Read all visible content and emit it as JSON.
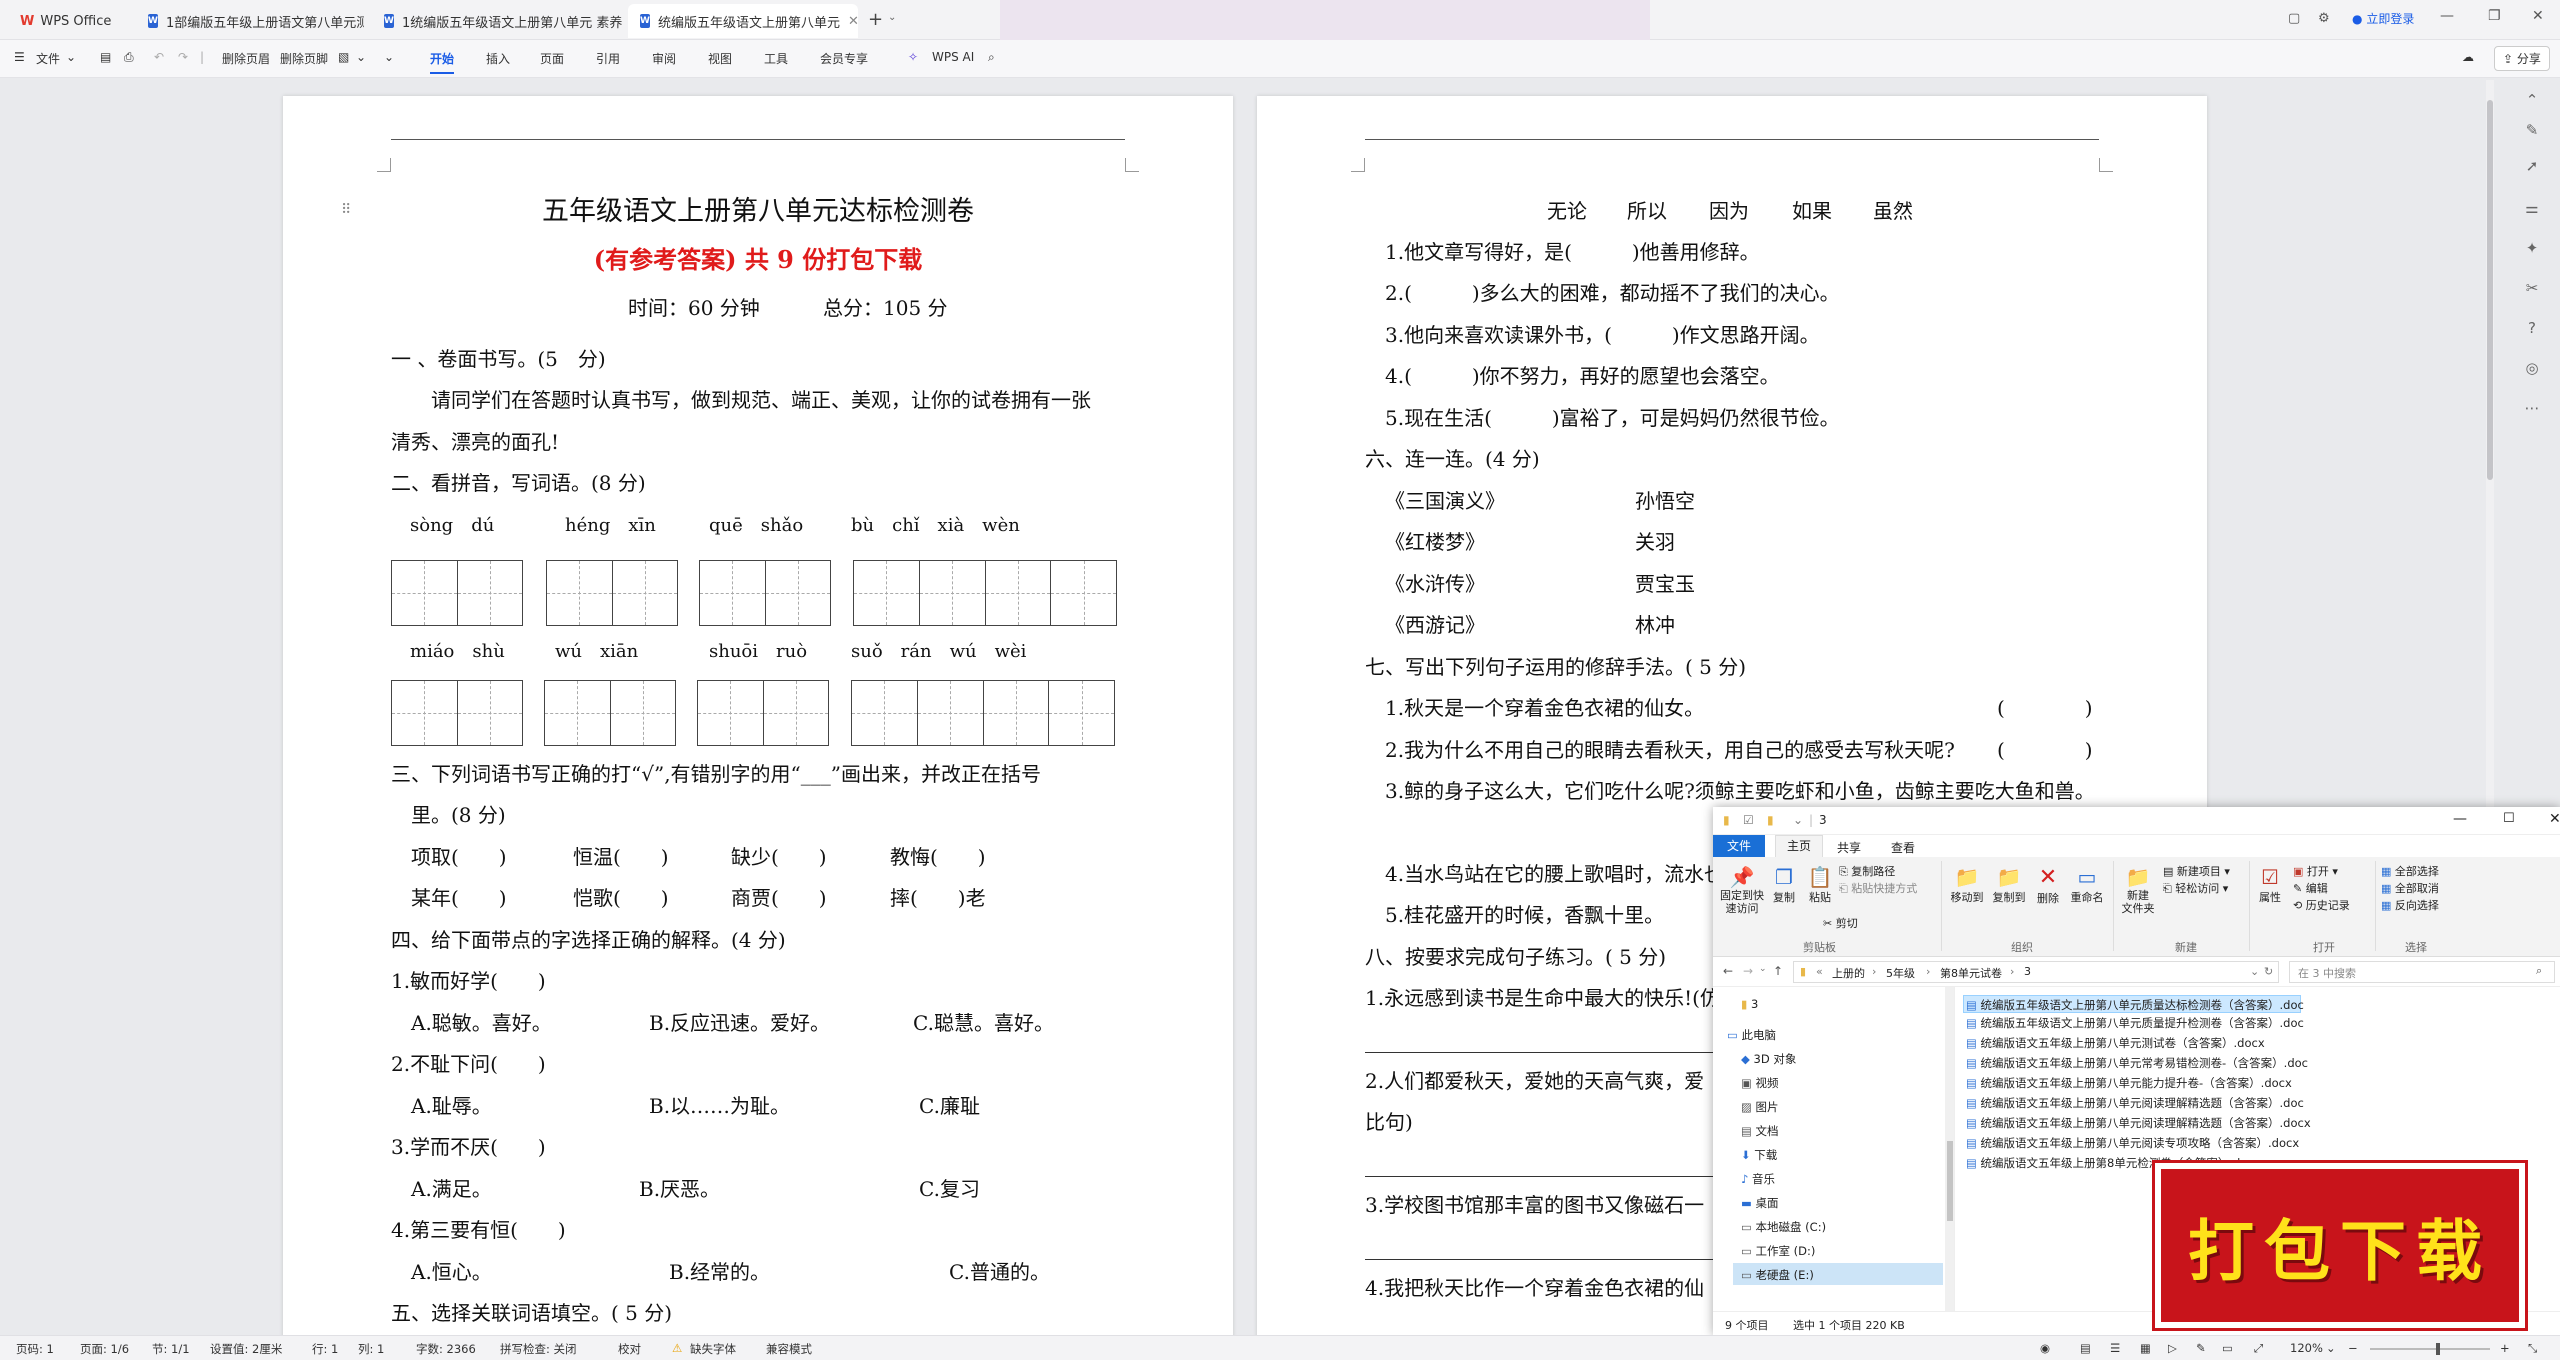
{
  "app": {
    "name": "WPS Office"
  },
  "tabs": [
    {
      "label": "1部编版五年级上册语文第八单元测试"
    },
    {
      "label": "1统编版五年级语文上册第八单元 素养"
    },
    {
      "label": "统编版五年级语文上册第八单元"
    }
  ],
  "titlebar": {
    "login": "立即登录",
    "new_tab": "+"
  },
  "toolbar": {
    "file": "文件",
    "delete_header": "删除页眉",
    "delete_footer": "删除页脚",
    "menus": [
      "开始",
      "插入",
      "页面",
      "引用",
      "审阅",
      "视图",
      "工具",
      "会员专享"
    ],
    "ai": "WPS AI",
    "share": "分享"
  },
  "page1": {
    "title": "五年级语文上册第八单元达标检测卷",
    "subtitle": "(有参考答案) 共 9 份打包下载",
    "time": "时间：60 分钟",
    "total": "总分：105 分",
    "s1": "一 、卷面书写。(5　分)",
    "s1_text1": "请同学们在答题时认真书写，做到规范、端正、美观，让你的试卷拥有一张",
    "s1_text2": "清秀、漂亮的面孔!",
    "s2": "二、看拼音，写词语。(8 分)",
    "pinyin_row1": [
      "sòng　dú",
      "héng　xīn",
      "quē　shǎo",
      "bù　chǐ　xià　wèn"
    ],
    "pinyin_row2": [
      "miáo　shù",
      "wú　xiān",
      "shuōi　ruò",
      "suǒ　rán　wú　wèi"
    ],
    "s3a": "三、下列词语书写正确的打“√”,有错别字的用“___”画出来，并改正在括号",
    "s3b": "里。(8 分)",
    "s3_row1": [
      "项取(　　)",
      "恒温(　　)",
      "缺少(　　)",
      "教悔(　　)"
    ],
    "s3_row2": [
      "某年(　　)",
      "恺歌(　　)",
      "商贾(　　)",
      "摔(　　)老"
    ],
    "s4": "四、给下面带点的字选择正确的解释。(4 分)",
    "q1": "1.敏而好学(　　)",
    "q1_opts": [
      "A.聪敏。喜好。",
      "B.反应迅速。爱好。",
      "C.聪慧。喜好。"
    ],
    "q2": "2.不耻下问(　　)",
    "q2_opts": [
      "A.耻辱。",
      "B.以……为耻。",
      "C.廉耻"
    ],
    "q3": "3.学而不厌(　　)",
    "q3_opts": [
      "A.满足。",
      "B.厌恶。",
      "C.复习"
    ],
    "q4": "4.第三要有恒(　　)",
    "q4_opts": [
      "A.恒心。",
      "B.经常的。",
      "C.普通的。"
    ],
    "s5": "五、选择关联词语填空。( 5 分)"
  },
  "page2": {
    "words": [
      "无论",
      "所以",
      "因为",
      "如果",
      "虽然"
    ],
    "l1": "1.他文章写得好，是(　　　)他善用修辞。",
    "l2": "2.(　　　)多么大的困难，都动摇不了我们的决心。",
    "l3": "3.他向来喜欢读课外书，(　　　)作文思路开阔。",
    "l4": "4.(　　　)你不努力，再好的愿望也会落空。",
    "l5": "5.现在生活(　　　)富裕了，可是妈妈仍然很节俭。",
    "s6": "六、连一连。(4 分)",
    "books": [
      "《三国演义》",
      "《红楼梦》",
      "《水浒传》",
      "《西游记》"
    ],
    "names": [
      "孙悟空",
      "关羽",
      "贾宝玉",
      "林冲"
    ],
    "s7": "七、写出下列句子运用的修辞手法。( 5 分)",
    "r1": "1.秋天是一个穿着金色衣裙的仙女。",
    "r2": "2.我为什么不用自己的眼睛去看秋天，用自己的感受去写秋天呢?",
    "r3": "3.鲸的身子这么大，它们吃什么呢?须鲸主要吃虾和小鱼，齿鲸主要吃大鱼和兽。",
    "paren": "(　　　　)",
    "r4": "4.当水鸟站在它的腰上歌唱时，流水也",
    "r5": "5.桂花盛开的时候，香飘十里。",
    "s8": "八、按要求完成句子练习。( 5 分)",
    "e1": "1.永远感到读书是生命中最大的快乐!(仿",
    "e2": "2.人们都爱秋天，爱她的天高气爽，爱",
    "e2b": "比句)",
    "e3": "3.学校图书馆那丰富的图书又像磁石一",
    "e4": "4.我把秋天比作一个穿着金色衣裙的仙"
  },
  "explorer": {
    "title": "3",
    "ribbon_tabs": [
      "文件",
      "主页",
      "共享",
      "查看"
    ],
    "pin": "固定到快\n速访问",
    "copy": "复制",
    "paste": "粘贴",
    "copy_path": "复制路径",
    "paste_shortcut": "粘贴快捷方式",
    "cut": "剪切",
    "clipboard": "剪贴板",
    "move_to": "移动到",
    "copy_to": "复制到",
    "delete": "删除",
    "rename": "重命名",
    "organize": "组织",
    "new_item": "新建项目",
    "easy_access": "轻松访问",
    "new_folder": "新建\n文件夹",
    "new_group": "新建",
    "properties": "属性",
    "open": "打开",
    "edit": "编辑",
    "history": "历史记录",
    "open_group": "打开",
    "select_all": "全部选择",
    "select_none": "全部取消",
    "invert": "反向选择",
    "select_group": "选择",
    "breadcrumb": [
      "上册的",
      "5年级",
      "第8单元试卷",
      "3"
    ],
    "search_placeholder": "在 3 中搜索",
    "nav": [
      "3",
      "此电脑",
      "3D 对象",
      "视频",
      "图片",
      "文档",
      "下载",
      "音乐",
      "桌面",
      "本地磁盘 (C:)",
      "工作室 (D:)",
      "老硬盘 (E:)"
    ],
    "files": [
      "统编版五年级语文上册第八单元质量达标检测卷（含答案）.doc",
      "统编版五年级语文上册第八单元质量提升检测卷（含答案）.doc",
      "统编版语文五年级上册第八单元测试卷（含答案）.docx",
      "统编版语文五年级上册第八单元常考易错检测卷-（含答案）.doc",
      "统编版语文五年级上册第八单元能力提升卷-（含答案）.docx",
      "统编版语文五年级上册第八单元阅读理解精选题（含答案）.doc",
      "统编版语文五年级上册第八单元阅读理解精选题（含答案）.docx",
      "统编版语文五年级上册第八单元阅读专项攻略（含答案）.docx",
      "统编版语文五年级上册第8单元检测卷（含答案）.doc"
    ],
    "status_count": "9 个项目",
    "status_selected": "选中 1 个项目  220 KB"
  },
  "promo": {
    "text": "打包下载"
  },
  "statusbar": {
    "page": "页码: 1",
    "pages": "页面: 1/6",
    "section": "节: 1/1",
    "setting": "设置值: 2厘米",
    "row": "行: 1",
    "col": "列: 1",
    "words": "字数: 2366",
    "spell": "拼写检查: 关闭",
    "proof": "校对",
    "missing_font": "缺失字体",
    "compat": "兼容模式",
    "zoom": "120%"
  }
}
